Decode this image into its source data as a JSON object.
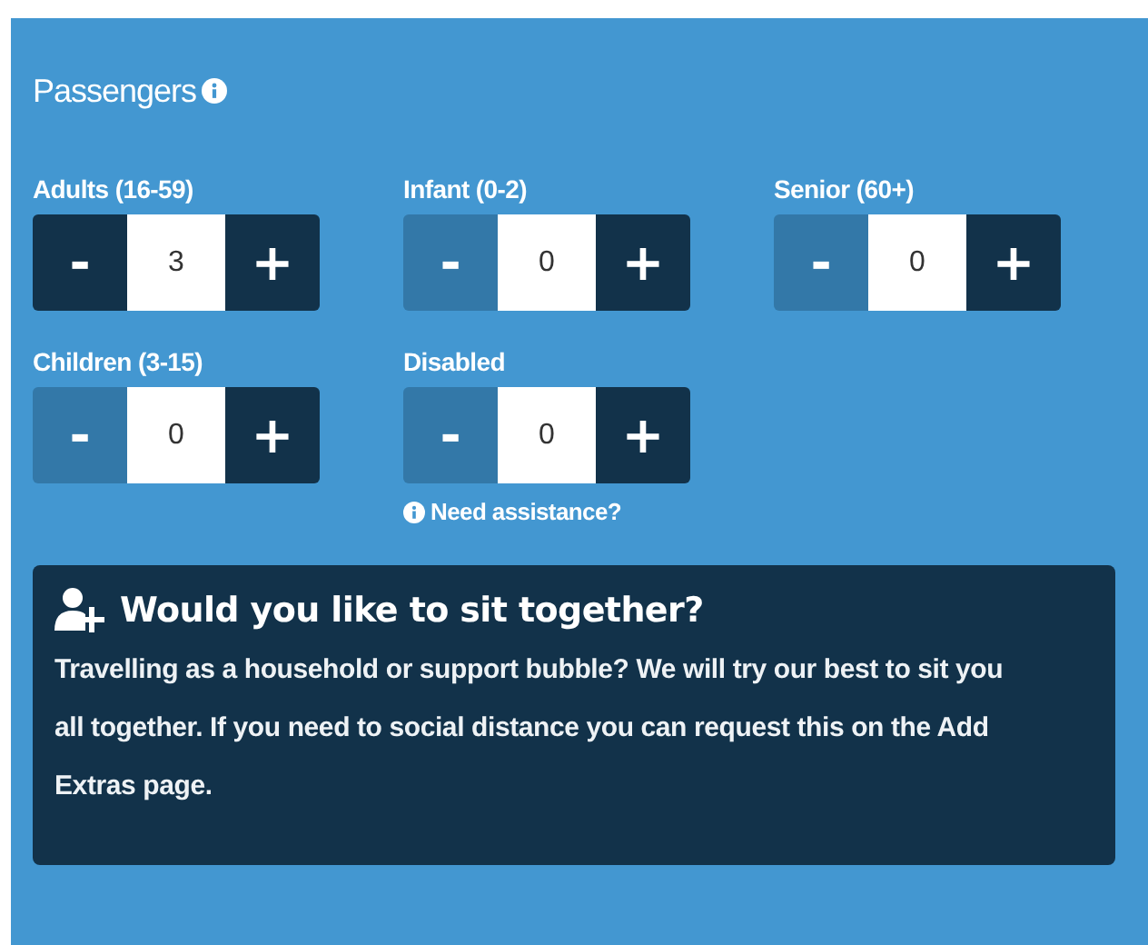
{
  "section": {
    "title": "Passengers"
  },
  "counters": [
    {
      "label": "Adults (16-59)",
      "minus": "-",
      "value": "3",
      "plus": "+",
      "decrease_disabled": false
    },
    {
      "label": "Infant (0-2)",
      "minus": "-",
      "value": "0",
      "plus": "+",
      "decrease_disabled": true
    },
    {
      "label": "Senior (60+)",
      "minus": "-",
      "value": "0",
      "plus": "+",
      "decrease_disabled": true
    },
    {
      "label": "Children (3-15)",
      "minus": "-",
      "value": "0",
      "plus": "+",
      "decrease_disabled": true
    },
    {
      "label": "Disabled",
      "minus": "-",
      "value": "0",
      "plus": "+",
      "decrease_disabled": true,
      "note": "Need assistance?"
    }
  ],
  "notice": {
    "title": "Would you like to sit together?",
    "body": "Travelling as a household or support bubble? We will try our best to sit you all together. If you need to social distance you can request this on the Add Extras page."
  }
}
